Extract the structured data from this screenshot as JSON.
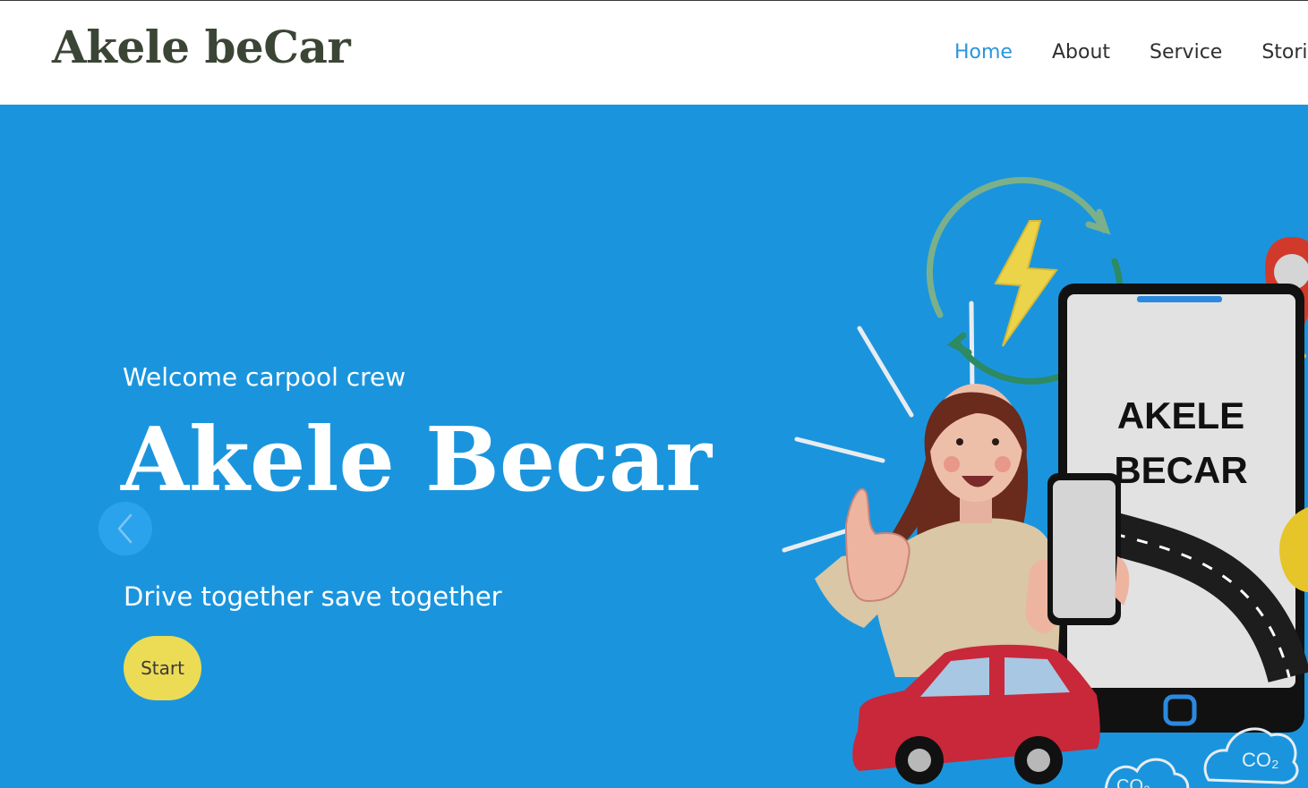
{
  "header": {
    "brand": "Akele beCar",
    "nav": [
      {
        "label": "Home",
        "active": true
      },
      {
        "label": "About",
        "active": false
      },
      {
        "label": "Service",
        "active": false
      },
      {
        "label": "Stories",
        "active": false
      }
    ]
  },
  "hero": {
    "welcome": "Welcome carpool crew",
    "title": "Akele Becar",
    "tagline": "Drive together save together",
    "start_label": "Start",
    "prev_icon": "chevron-left-icon",
    "illustration": {
      "tablet_text_line1": "AKELE",
      "tablet_text_line2": "BECAR",
      "co2_label": "CO₂"
    }
  },
  "colors": {
    "hero_bg": "#1a95dd",
    "nav_active": "#2b95dd",
    "brand": "#3b4536",
    "start_button": "#ecdb55",
    "car_red": "#c8283a"
  }
}
